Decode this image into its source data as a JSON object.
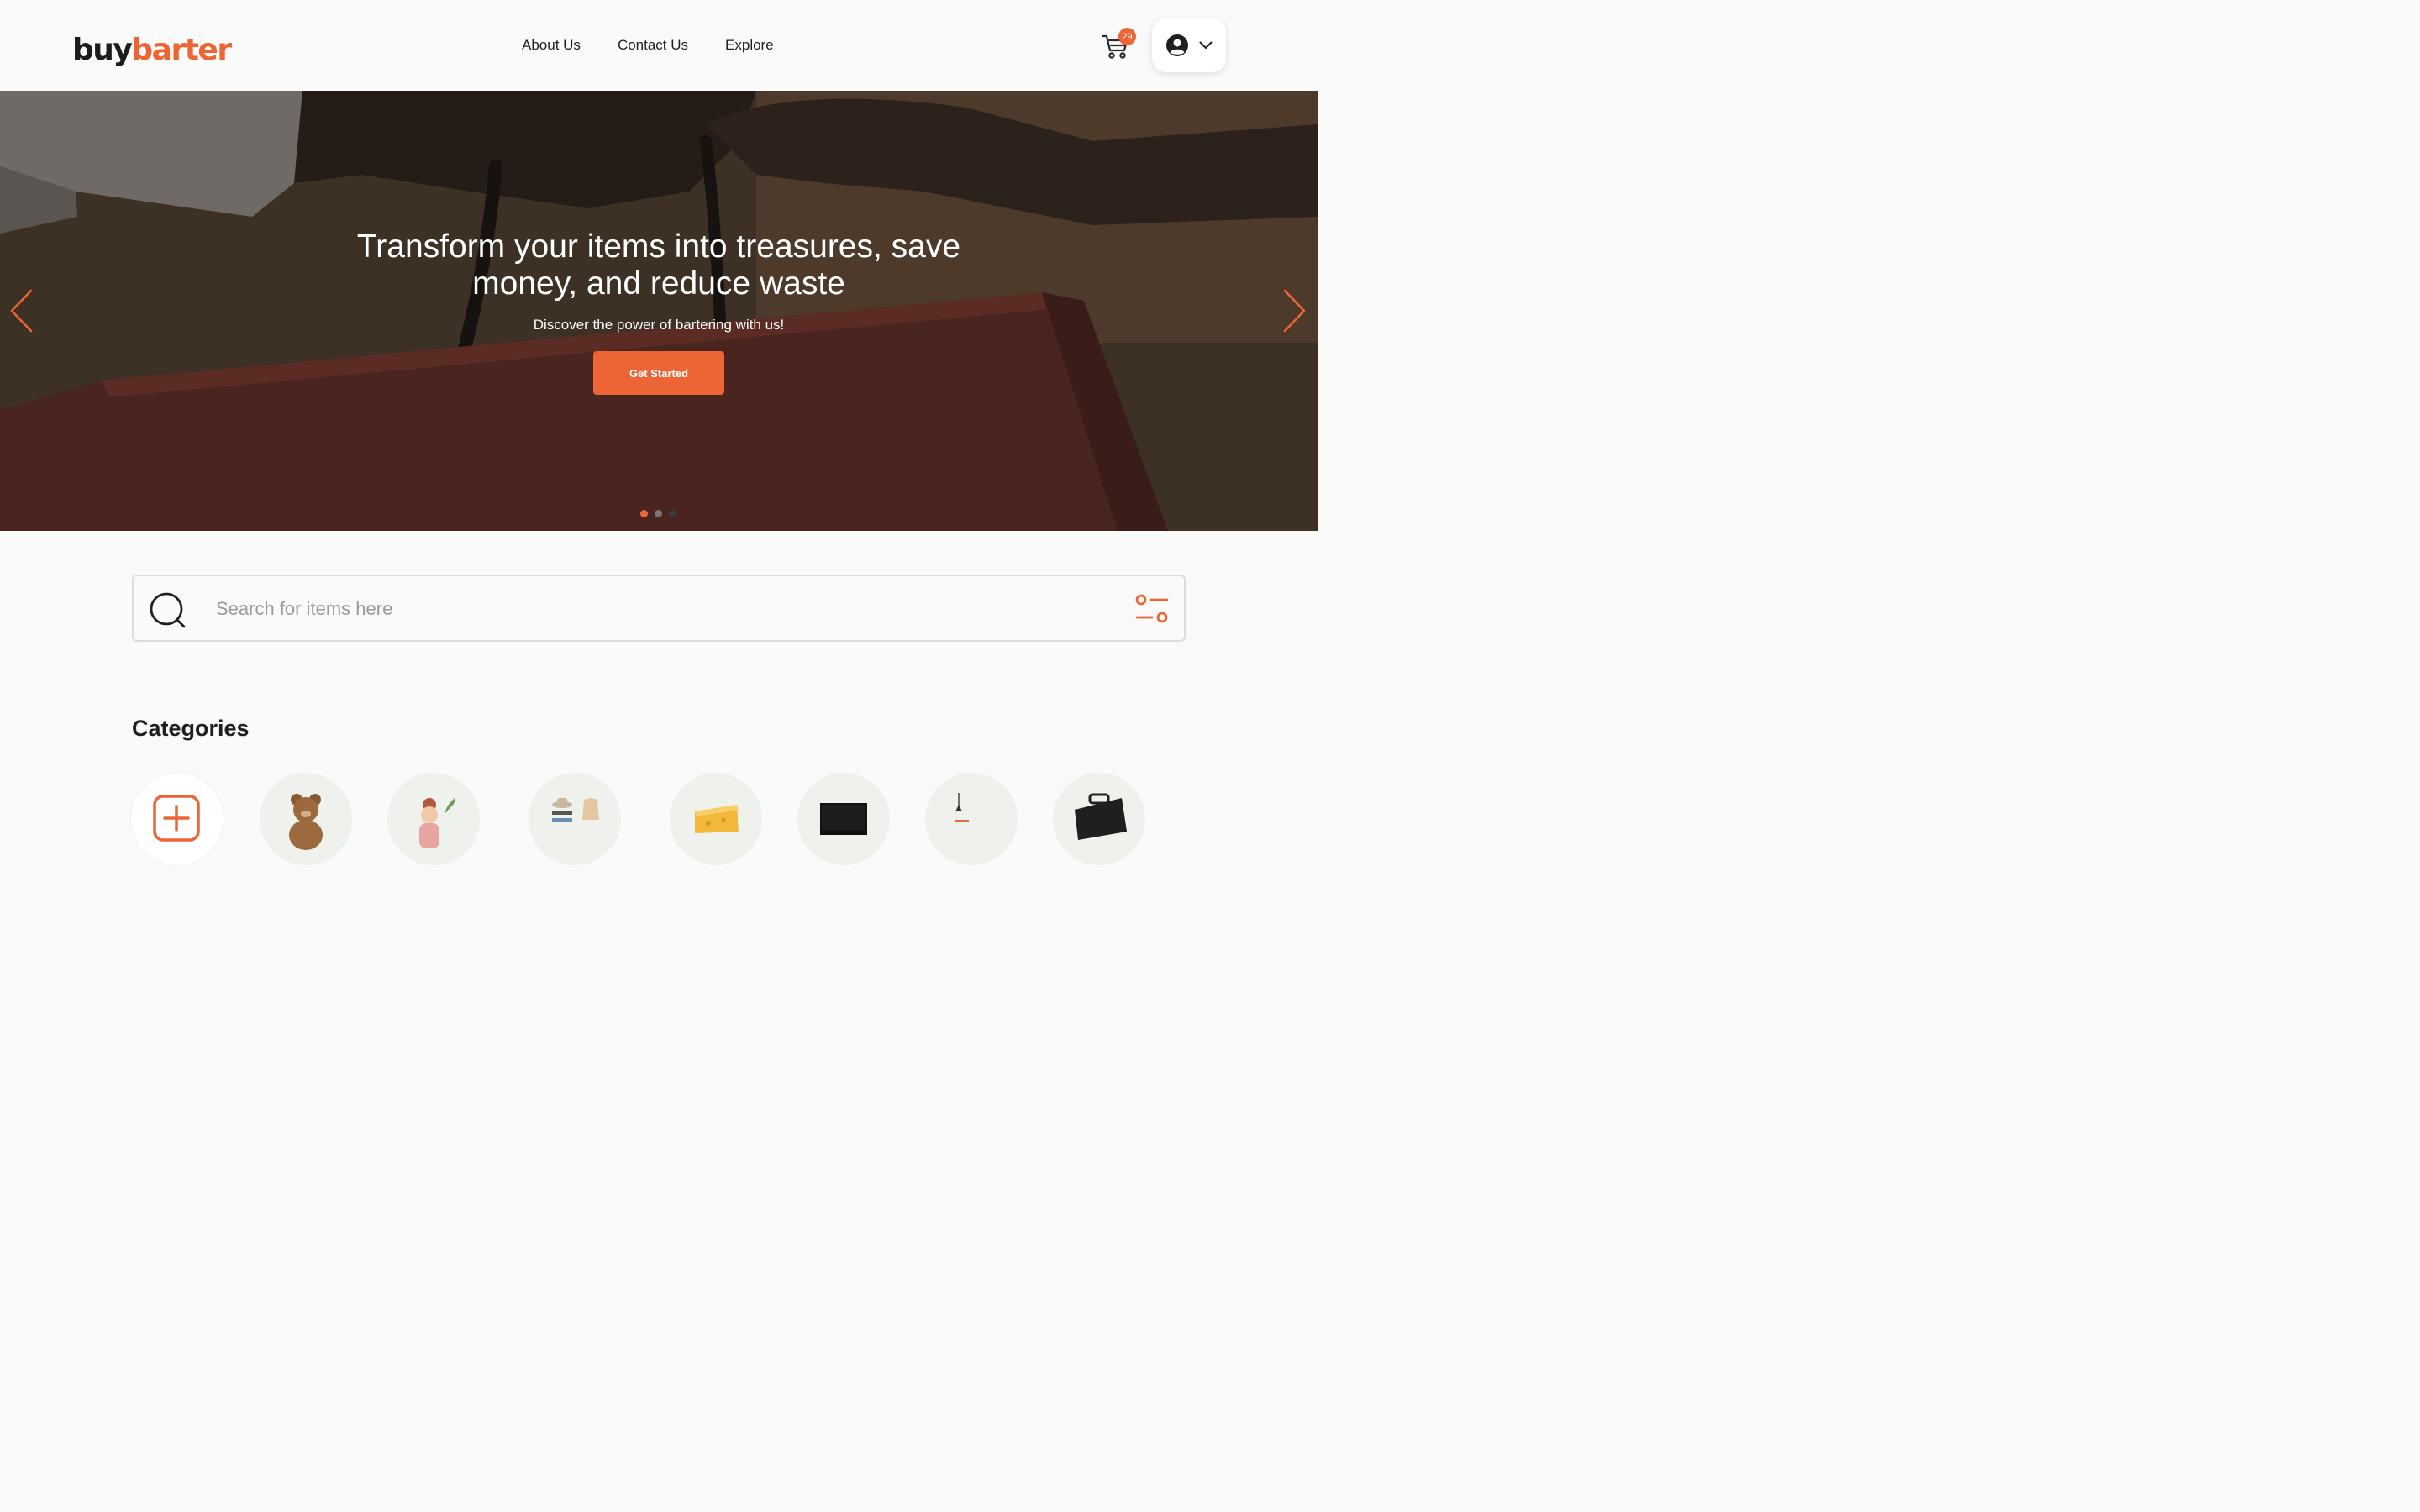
{
  "brand": {
    "logo_buy": "buy",
    "logo_barter": "barter",
    "accent_color": "#ee6535"
  },
  "nav": {
    "items": [
      {
        "label": "About Us"
      },
      {
        "label": "Contact Us"
      },
      {
        "label": "Explore"
      }
    ]
  },
  "header": {
    "cart_icon": "cart-icon",
    "cart_count": "29",
    "profile_icon": "user-circle-icon",
    "profile_menu_icon": "chevron-down-icon"
  },
  "hero": {
    "title": "Transform your items into treasures, save money, and reduce waste",
    "subtitle": "Discover the power of bartering with us!",
    "cta_label": "Get Started",
    "slide_count": 3,
    "active_slide": 1
  },
  "search": {
    "placeholder": "Search for items here",
    "value": ""
  },
  "categories": {
    "title": "Categories",
    "items": [
      {
        "icon": "add-category-icon"
      },
      {
        "icon": "teddy-bear-icon"
      },
      {
        "icon": "beauty-icon"
      },
      {
        "icon": "clothing-icon"
      },
      {
        "icon": "food-icon"
      },
      {
        "icon": "electronics-icon"
      },
      {
        "icon": "home-decor-icon"
      },
      {
        "icon": "briefcase-icon"
      }
    ]
  }
}
